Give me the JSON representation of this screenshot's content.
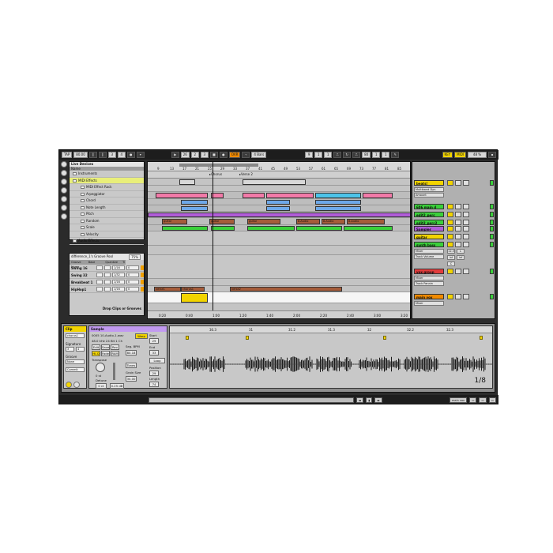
{
  "transport": {
    "tap_label": "TAP",
    "tempo": "80.00",
    "signature_num": "3",
    "signature_den": "4",
    "metronome_label": "",
    "position_bar": "26",
    "position_beat": "2",
    "position_sixteenth": "3",
    "ovr_label": "OVR",
    "quantize": "4 Bars",
    "loop_start": "9",
    "loop_start_beat": "1",
    "loop_start_sixteenth": "1",
    "loop_length_bar": "80",
    "loop_length_beat": "1",
    "loop_length_sixteenth": "1",
    "key_label": "KEY",
    "midi_label": "MIDI",
    "cpu_label": "48 %"
  },
  "browser": {
    "title": "Live Devices",
    "header": "Name",
    "items": [
      {
        "label": "Instruments",
        "level": 0,
        "selected": false
      },
      {
        "label": "MIDI Effects",
        "level": 0,
        "selected": true
      },
      {
        "label": "MIDI Effect Rack",
        "level": 1,
        "selected": false
      },
      {
        "label": "Arpeggiator",
        "level": 1,
        "selected": false
      },
      {
        "label": "Chord",
        "level": 1,
        "selected": false
      },
      {
        "label": "Note Length",
        "level": 1,
        "selected": false
      },
      {
        "label": "Pitch",
        "level": 1,
        "selected": false
      },
      {
        "label": "Random",
        "level": 1,
        "selected": false
      },
      {
        "label": "Scale",
        "level": 1,
        "selected": false
      },
      {
        "label": "Velocity",
        "level": 1,
        "selected": false
      },
      {
        "label": "Audio Effects",
        "level": 0,
        "selected": false
      }
    ]
  },
  "groovepool": {
    "title": "difference_1's Groove Pool",
    "amount": "75%",
    "headers": [
      "Groove Name",
      "Base",
      "Quantize",
      "Ti"
    ],
    "rows": [
      {
        "name": "Swing 16",
        "base": "1/16",
        "quant": "0"
      },
      {
        "name": "Swing 32",
        "base": "1/32",
        "quant": "0"
      },
      {
        "name": "Breakbeat 1",
        "base": "1/16",
        "quant": "0"
      },
      {
        "name": "HipHop1",
        "base": "1/16",
        "quant": "0"
      }
    ],
    "drop_hint": "Drop Clips or Grooves"
  },
  "arrangement": {
    "ruler": [
      "9",
      "13",
      "17",
      "21",
      "25",
      "29",
      "33",
      "37",
      "41",
      "45",
      "49",
      "53",
      "57",
      "61",
      "65",
      "69",
      "73",
      "77",
      "81",
      "85",
      "89"
    ],
    "locators": [
      "Chorus",
      "Verse 2"
    ],
    "times": [
      "0:20",
      "0:40",
      "1:00",
      "1:20",
      "1:40",
      "2:00",
      "2:20",
      "2:40",
      "3:00",
      "3:20"
    ],
    "clip_labels": {
      "guitar_a": "guitar",
      "guitar_b": "guitar",
      "guitar_c": "guitar",
      "audio_a": "8-Audio",
      "audio_b": "8-Audio",
      "audio_c": "8-Audio",
      "verse1": "verse1",
      "chorus1": "chorus1",
      "verse2": "verse2"
    }
  },
  "mixer": {
    "tracks": [
      {
        "name": "beats!",
        "color": "#f2d400",
        "device": "Multiband Dyn",
        "param": "Amount"
      },
      {
        "name": "606 main d",
        "color": "#3ad03a",
        "device": "",
        "param": ""
      },
      {
        "name": "edit2_perc",
        "color": "#3ad03a",
        "device": "",
        "param": ""
      },
      {
        "name": "edit2_perc2",
        "color": "#3ad03a",
        "device": "",
        "param": ""
      },
      {
        "name": "Sampler",
        "color": "#b05cd8",
        "device": "",
        "param": ""
      },
      {
        "name": "guitar",
        "color": "#f2d400",
        "device": "",
        "param": ""
      },
      {
        "name": "synth bass",
        "color": "#3ad03a",
        "device": "Mixer",
        "param": "Track Volume"
      },
      {
        "name": "vox group",
        "color": "#e23c3c",
        "device": "Mixer",
        "param": "Track Pannin"
      },
      {
        "name": "main vox",
        "color": "#f08a00",
        "device": "Mixer",
        "param": ""
      }
    ],
    "values": [
      "12.3",
      "L",
      "inf",
      "inf",
      "C"
    ]
  },
  "clip": {
    "title": "Clip",
    "name": "chorus1",
    "signature_label": "Signature",
    "signature_num": "3",
    "signature_den": "4",
    "groove_label": "Groove",
    "groove_value": "None",
    "commit_label": "Commit"
  },
  "sample": {
    "title": "Sample",
    "file": "0005 10-Audio-1.wav",
    "format": "48.0 kHz 24 Bit 1 Ch",
    "edit_label": "Edit",
    "save_label": "Save",
    "rev_label": "Rev",
    "hiq_label": "Hi-Q",
    "fade_label": "Fade",
    "ram_label": "RAM",
    "warp_label": "Warp",
    "seg_bpm_label": "Seg. BPM",
    "seg_bpm": "80.18",
    "start_label": "Start",
    "start_value": "29",
    "end_label": "End",
    "end_value": "33",
    "loop_label": "Loop",
    "position_label": "Position",
    "position_value": "29",
    "length_label": "Length",
    "length_value": "74",
    "transpose_label": "Transpose",
    "transpose_value": "0 st",
    "detune_label": "Detune",
    "detune_value": "0 ct",
    "gain_value": "0.25 dB",
    "grain_label": "Grain Size",
    "grain_value": "30.00",
    "mode_label": "Tones"
  },
  "waveform": {
    "ruler": [
      "30.3",
      "31",
      "31.2",
      "31.3",
      "32",
      "32.2",
      "32.3"
    ],
    "zoom": "1/8"
  },
  "status": {
    "message": "",
    "track_label": "main vox"
  },
  "colors": {
    "yellow": "#f2d400",
    "green": "#3ad03a",
    "orange": "#f08a00",
    "purple": "#b05cd8",
    "brown": "#a55c3a",
    "cyan": "#4cc3e8",
    "pink": "#f27aa8",
    "blue": "#6ea8e8",
    "red": "#e23c3c"
  }
}
